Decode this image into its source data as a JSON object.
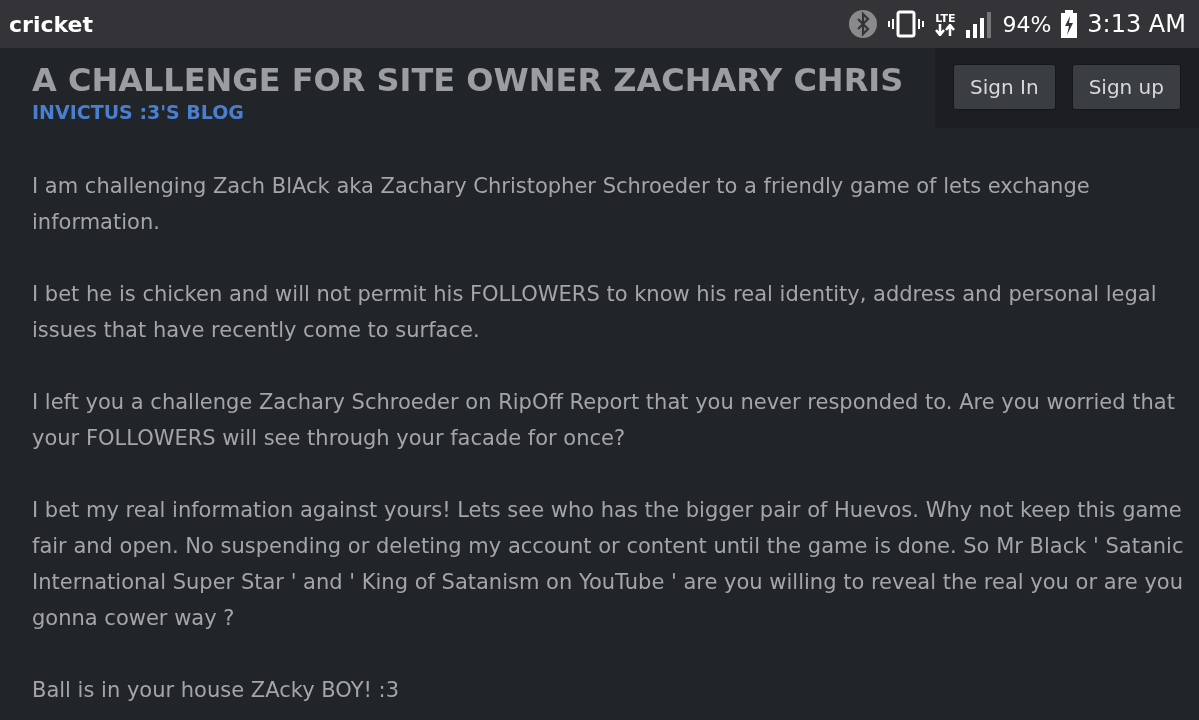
{
  "status_bar": {
    "carrier": "cricket",
    "network": "LTE",
    "battery": "94%",
    "time": "3:13 AM"
  },
  "header": {
    "title": "A CHALLENGE FOR SITE OWNER ZACHARY CHRIS",
    "subtitle": "INVICTUS :3'S BLOG",
    "buttons": [
      "Sign In",
      "Sign up"
    ]
  },
  "post": {
    "paragraphs": [
      "I am challenging Zach BlAck aka Zachary Christopher Schroeder to a friendly game of lets exchange information.",
      "I bet he is chicken and will not permit his FOLLOWERS to know his real identity, address and personal legal issues that have recently come to surface.",
      "I left you a challenge Zachary Schroeder on RipOff Report that you never responded to. Are you worried that your FOLLOWERS will see through your facade for once?",
      "I bet my real information against yours! Lets see who has the bigger pair of Huevos. Why not keep this game fair and open. No suspending or deleting my account or content until the game is done. So Mr Black ' Satanic International Super Star ' and ' King of Satanism on YouTube ' are you willing to reveal the real you or are you gonna cower way ?",
      "Ball is in your house ZAcky BOY! :3"
    ]
  }
}
